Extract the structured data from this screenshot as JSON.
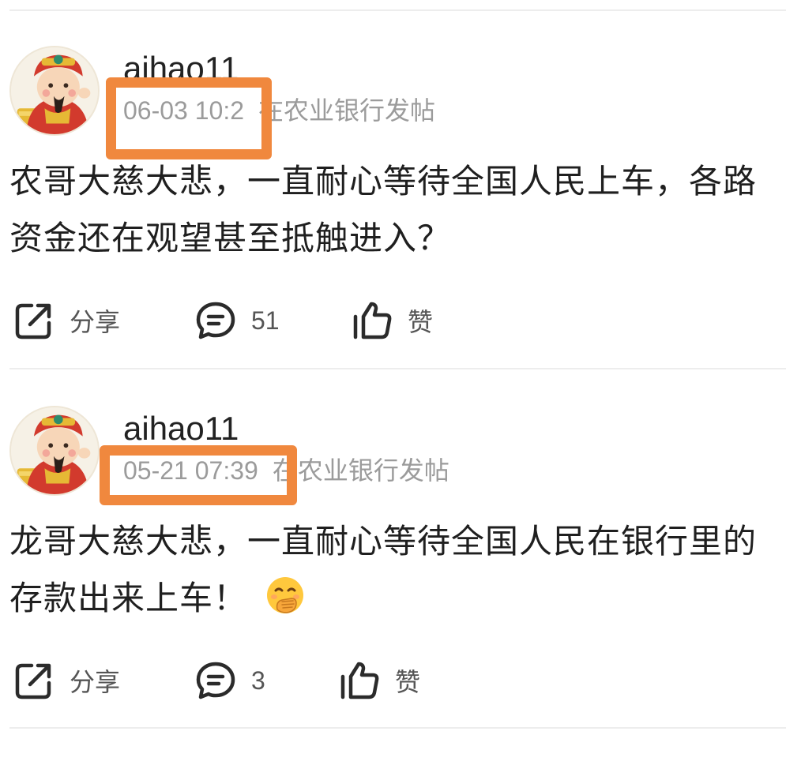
{
  "posts": [
    {
      "username": "aihao11",
      "time": "06-03 10:2",
      "source": "在农业银行发帖",
      "content": "农哥大慈大悲，一直耐心等待全国人民上车，各路资金还在观望甚至抵触进入？",
      "share_label": "分享",
      "comment_count": "51",
      "like_label": "赞",
      "highlight_color": "#f0883e"
    },
    {
      "username": "aihao11",
      "time": "05-21 07:39",
      "source": "在农业银行发帖",
      "content": "龙哥大慈大悲，一直耐心等待全国人民在银行里的存款出来上车！",
      "content_emoji": "hand-over-mouth-emoji",
      "share_label": "分享",
      "comment_count": "3",
      "like_label": "赞",
      "highlight_color": "#f0883e"
    }
  ],
  "icons": {
    "share": "share-icon",
    "comment": "comment-icon",
    "like": "thumbs-up-icon"
  }
}
